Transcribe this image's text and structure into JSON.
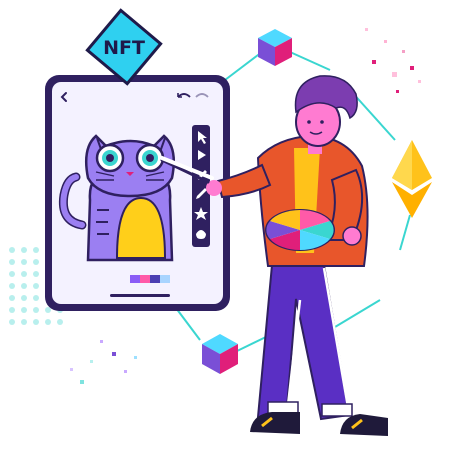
{
  "badge": {
    "label": "NFT"
  },
  "tablet": {
    "nav": {
      "back_icon": "chevron-left-icon",
      "undo_icon": "undo-icon",
      "redo_icon": "redo-icon"
    },
    "tools": [
      "cursor-icon",
      "play-icon",
      "pen-icon",
      "pencil-icon",
      "star-icon",
      "fill-icon"
    ],
    "swatches": [
      "#8a5cf6",
      "#ff5aa8",
      "#4b3fb3",
      "#a8d4ff"
    ]
  },
  "colors": {
    "tablet_frame": "#2f2060",
    "tablet_screen": "#f4f2ff",
    "accent_cyan": "#3ad6d0",
    "accent_purple": "#7a4fd6",
    "accent_pink": "#e01f7a",
    "ethereum": "#ffc21a",
    "jacket": "#e8562b",
    "pants": "#5a2fc4",
    "hair": "#7c3db0",
    "skin": "#ff7bd1",
    "badge_fill": "#2fd0f0",
    "badge_text": "#1f1a4a"
  },
  "icons": [
    "nft-badge",
    "ethereum-icon",
    "cube-icon",
    "cube-icon",
    "cat-drawing",
    "paint-palette"
  ]
}
